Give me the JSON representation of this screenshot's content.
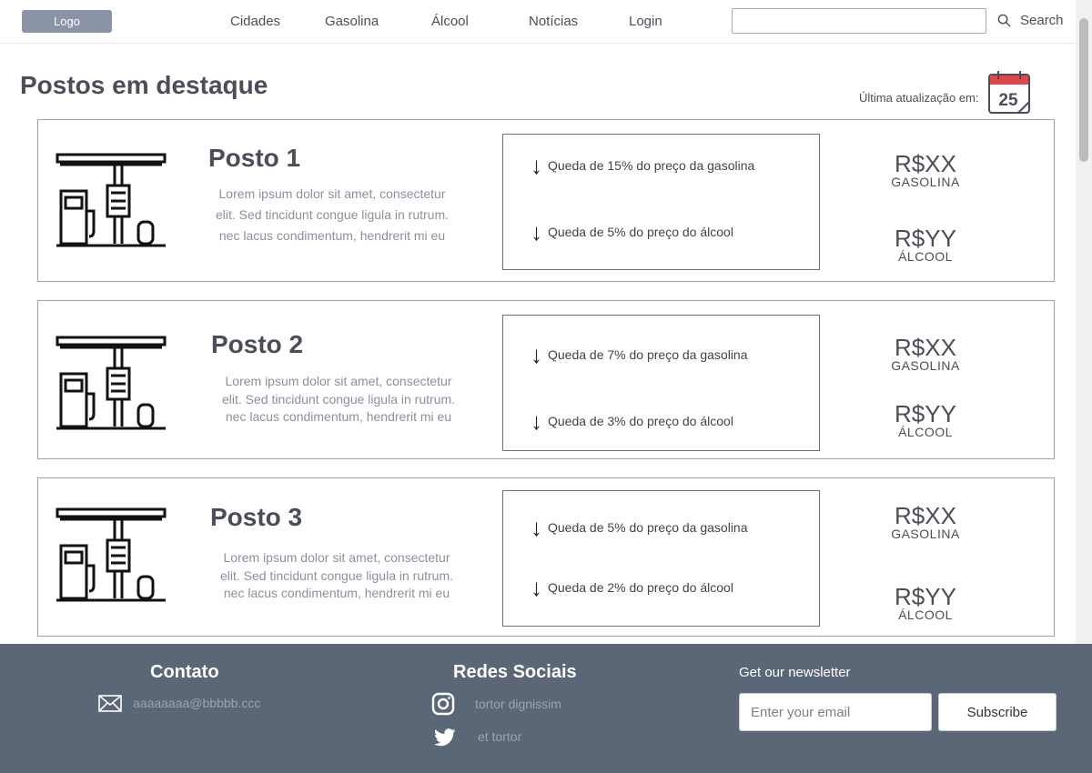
{
  "header": {
    "logo": "Logo",
    "nav": [
      {
        "label": "Cidades"
      },
      {
        "label": "Gasolina"
      },
      {
        "label": "Álcool"
      },
      {
        "label": "Notícias"
      },
      {
        "label": "Login"
      }
    ],
    "search_placeholder": "",
    "search_label": "Search",
    "search_icon": "search-icon"
  },
  "main": {
    "title": "Postos em destaque",
    "update_label": "Última atualização em:",
    "calendar_day": "25",
    "calendar_icon": "calendar-icon"
  },
  "stations": [
    {
      "name": "Posto 1",
      "description": [
        "Lorem ipsum dolor sit amet, consectetur",
        "elit. Sed tincidunt congue ligula in rutrum.",
        "nec lacus condimentum, hendrerit mi eu"
      ],
      "drop_gasoline": "Queda de 15% do preço da gasolina",
      "drop_alcohol": "Queda de 5% do preço do álcool",
      "price_gasoline": "R$XX",
      "label_gasoline": "GASOLINA",
      "price_alcohol": "R$YY",
      "label_alcohol": "ÁLCOOL"
    },
    {
      "name": "Posto 2",
      "description": [
        "Lorem ipsum dolor sit amet, consectetur",
        "elit. Sed tincidunt congue ligula in rutrum.",
        "nec lacus condimentum, hendrerit mi eu"
      ],
      "drop_gasoline": "Queda de 7% do preço da gasolina",
      "drop_alcohol": "Queda de 3% do preço do álcool",
      "price_gasoline": "R$XX",
      "label_gasoline": "GASOLINA",
      "price_alcohol": "R$YY",
      "label_alcohol": "ÁLCOOL"
    },
    {
      "name": "Posto 3",
      "description": [
        "Lorem ipsum dolor sit amet, consectetur",
        "elit. Sed tincidunt congue ligula in rutrum.",
        "nec lacus condimentum, hendrerit mi eu"
      ],
      "drop_gasoline": "Queda de 5% do preço da gasolina",
      "drop_alcohol": "Queda de 2% do preço do álcool",
      "price_gasoline": "R$XX",
      "label_gasoline": "GASOLINA",
      "price_alcohol": "R$YY",
      "label_alcohol": "ÁLCOOL"
    }
  ],
  "footer": {
    "contact_title": "Contato",
    "contact_email": "aaaaaaaa@bbbbb.ccc",
    "social_title": "Redes Sociais",
    "social": [
      {
        "icon": "instagram-icon",
        "label": "tortor dignissim"
      },
      {
        "icon": "twitter-icon",
        "label": "et tortor"
      }
    ],
    "newsletter_title": "Get our newsletter",
    "newsletter_placeholder": "Enter your email",
    "subscribe_label": "Subscribe"
  },
  "colors": {
    "footer_bg": "#5b6777",
    "logo_bg": "#8a94a6",
    "calendar_red": "#e0474c"
  }
}
